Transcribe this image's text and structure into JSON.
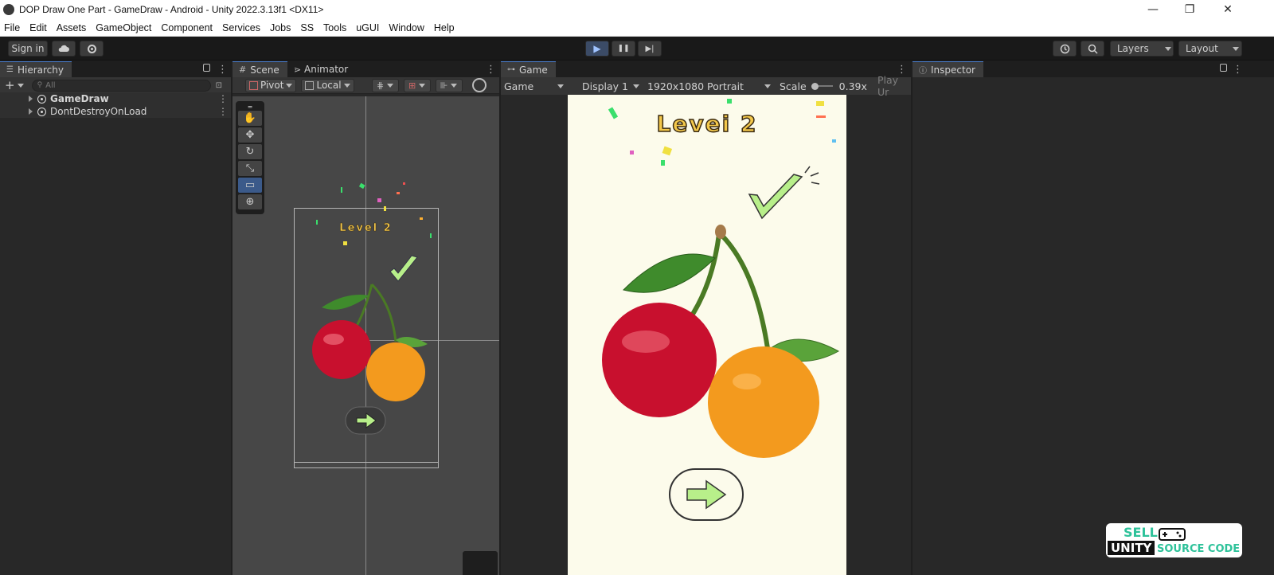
{
  "window": {
    "title": "DOP Draw One Part - GameDraw - Android - Unity 2022.3.13f1 <DX11>",
    "min": "—",
    "restore": "❐",
    "close": "✕"
  },
  "menu": [
    "File",
    "Edit",
    "Assets",
    "GameObject",
    "Component",
    "Services",
    "Jobs",
    "SS",
    "Tools",
    "uGUI",
    "Window",
    "Help"
  ],
  "toolbar": {
    "signin": "Sign in",
    "cloud_icon": "cloud-icon",
    "settings_icon": "gear-icon",
    "play": "▶",
    "pause": "❚❚",
    "step": "▶|",
    "layers": "Layers",
    "layout": "Layout"
  },
  "hierarchy": {
    "tab": "Hierarchy",
    "search_placeholder": "All",
    "add": "+",
    "items": [
      {
        "label": "GameDraw"
      },
      {
        "label": "DontDestroyOnLoad"
      }
    ]
  },
  "scene": {
    "tab_scene": "Scene",
    "tab_animator": "Animator",
    "pivot": "Pivot",
    "local": "Local",
    "level_text": "Level 2"
  },
  "game": {
    "tab": "Game",
    "mode": "Game",
    "display": "Display 1",
    "resolution": "1920x1080 Portrait",
    "scale_label": "Scale",
    "scale_value": "0.39x",
    "play_unfocused": "Play Ur",
    "level_text": "Levei 2"
  },
  "inspector": {
    "tab": "Inspector"
  },
  "watermark": {
    "line1": "SELL",
    "line2": "UNITY",
    "line3": "SOURCE CODE"
  },
  "colors": {
    "play_active": "#3b4b66",
    "panel_bg": "#282828",
    "game_bg": "#fcfbeb",
    "level_fill": "#f3c84b",
    "cherry": "#c8102e",
    "orange": "#f39a1e",
    "check": "#b8ef8a"
  }
}
